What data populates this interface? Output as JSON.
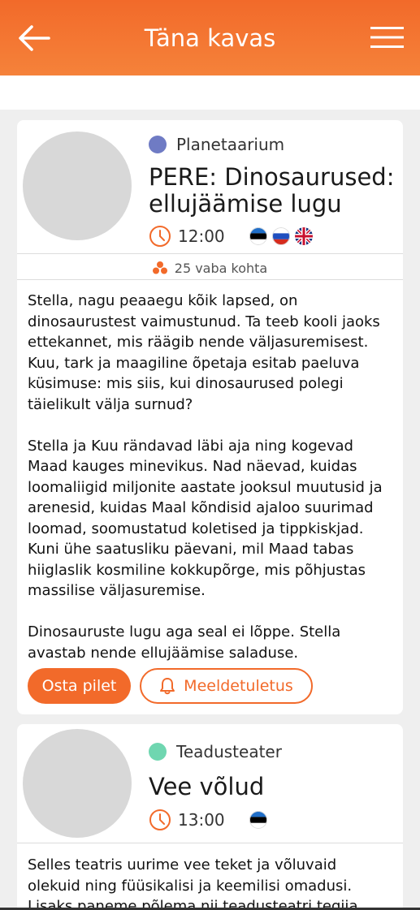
{
  "header": {
    "title": "Täna kavas",
    "back_icon": "arrow-left-icon",
    "menu_icon": "hamburger-menu-icon",
    "color": "#f26a2a"
  },
  "events": [
    {
      "category": "Planetaarium",
      "category_color": "#6f7bc4",
      "title": "PERE: Dinosaurused: ellujäämise lugu",
      "time": "12:00",
      "languages": [
        "et",
        "ru",
        "en"
      ],
      "seats": "25 vaba kohta",
      "description": [
        "Stella, nagu peaaegu kõik lapsed, on dinosaurustest vaimustunud. Ta teeb kooli jaoks ettekannet, mis räägib nende väljasuremisest. Kuu, tark ja maagiline õpetaja esitab paeluva küsimuse: mis siis, kui dinosaurused polegi täielikult välja surnud?",
        "Stella ja Kuu rändavad läbi aja ning kogevad Maad kauges minevikus. Nad näevad, kuidas loomaliigid miljonite aastate jooksul muutusid ja arenesid, kuidas Maal kõndisid ajaloo suurimad loomad, soomustatud koletised ja tippkiskjad. Kuni ühe saatusliku päevani, mil Maad tabas hiiglaslik kosmiline kokkupõrge, mis põhjustas massilise väljasuremise.",
        "Dinosauruste lugu aga seal ei lõppe. Stella avastab nende ellujäämise saladuse."
      ],
      "buy_label": "Osta pilet",
      "remind_label": "Meeldetuletus"
    },
    {
      "category": "Teadusteater",
      "category_color": "#6fd6b0",
      "title": "Vee võlud",
      "time": "13:00",
      "languages": [
        "et"
      ],
      "description": "Selles teatris uurime vee teket ja võluvaid olekuid ning füüsikalisi ja keemilisi omadusi. Lisaks paneme põlema nii teadusteatri tegija"
    }
  ]
}
